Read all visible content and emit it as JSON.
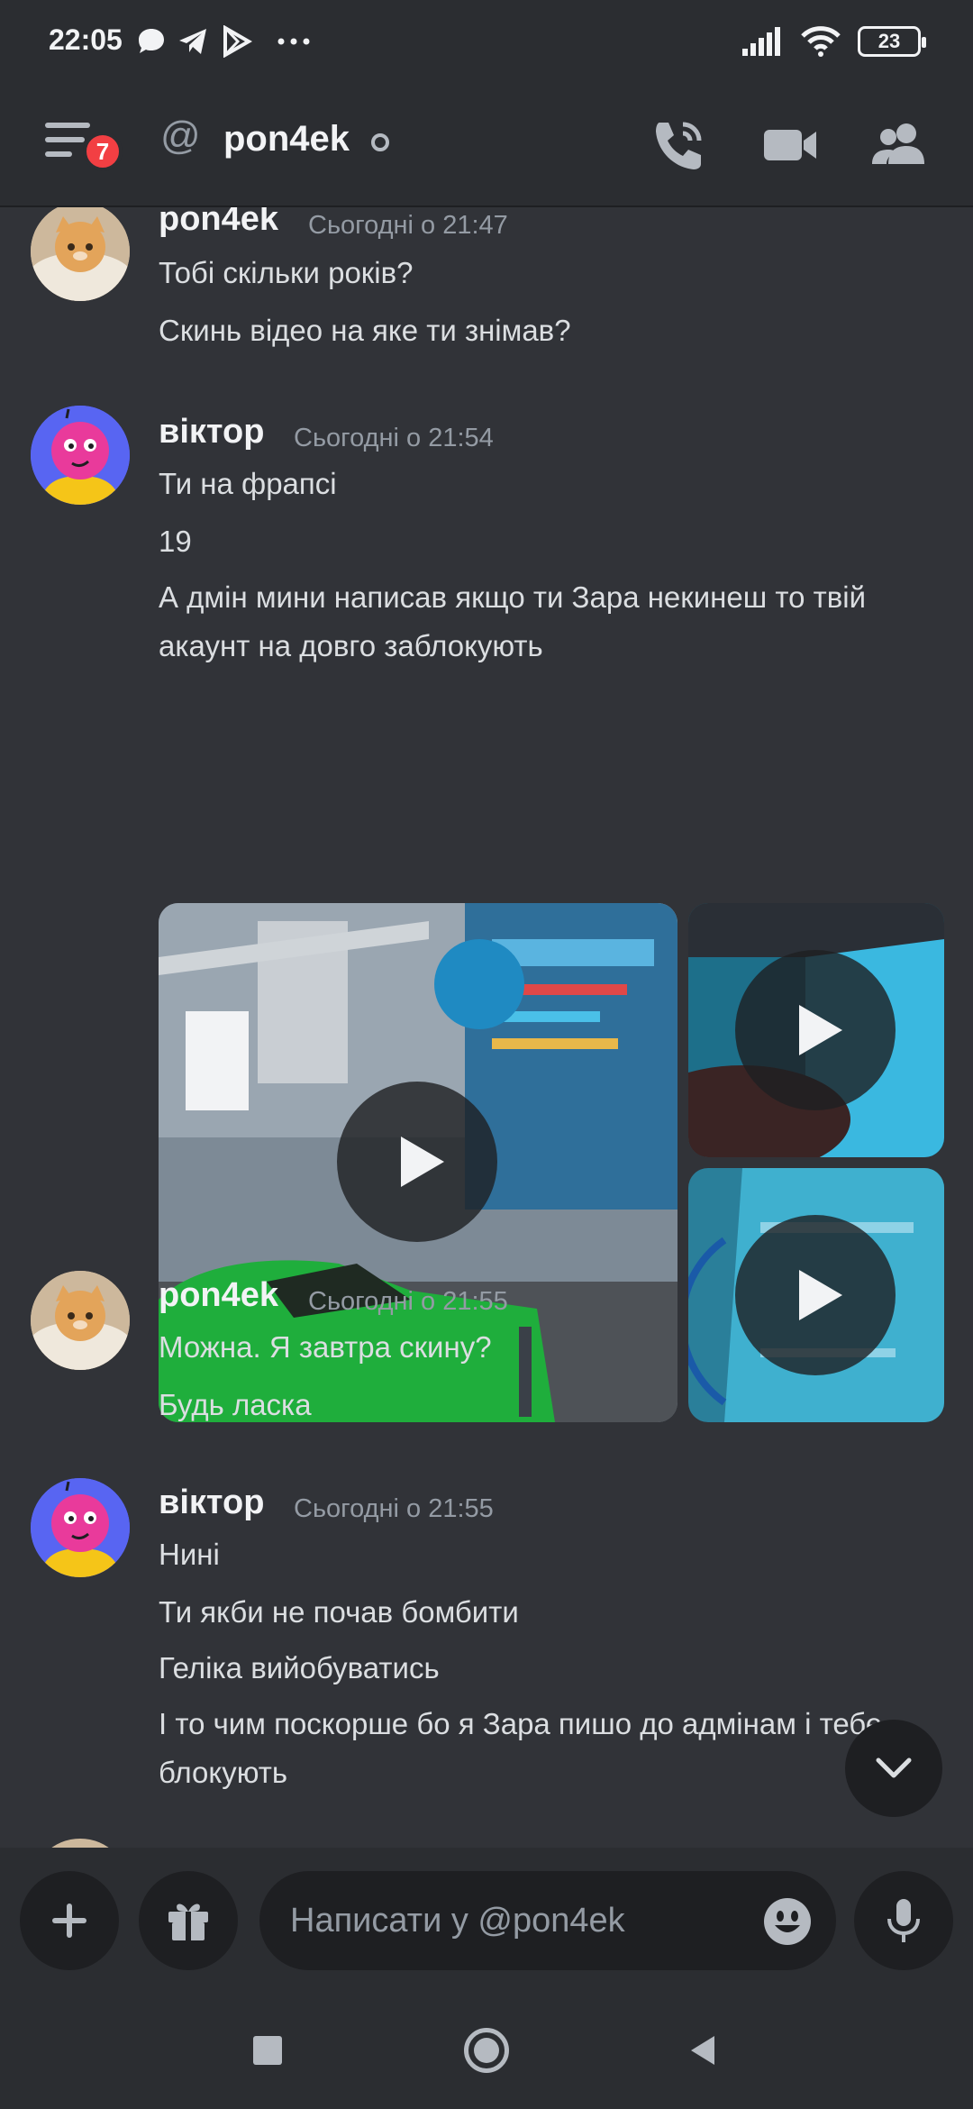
{
  "status_bar": {
    "time": "22:05",
    "battery": "23"
  },
  "header": {
    "unread_count": "7",
    "at_symbol": "@",
    "title": "pon4ek"
  },
  "messages": [
    {
      "username": "pon4ek",
      "timestamp": "Сьогодні о 21:47",
      "lines": [
        "Тобі скільки років?",
        "Скинь відео на яке ти знімав?"
      ]
    },
    {
      "username": "віктор",
      "timestamp": "Сьогодні о 21:54",
      "lines": [
        "Ти на фрапсі",
        "19",
        "А дмін мини написав якщо ти Зара некинеш то твій акаунт на довго заблокують"
      ],
      "attachments": [
        "video",
        "video",
        "video"
      ]
    },
    {
      "username": "pon4ek",
      "timestamp": "Сьогодні о 21:55",
      "lines": [
        "Можна. Я завтра скину?",
        "Будь ласка"
      ]
    },
    {
      "username": "віктор",
      "timestamp": "Сьогодні о 21:55",
      "lines": [
        "Нині",
        "Ти якби не почав бомбити",
        "Геліка вийобуватись",
        "І то чим поскорше бо я Зара пишо до адмінам і тебе блокують"
      ]
    }
  ],
  "composer": {
    "placeholder": "Написати у @pon4ek"
  },
  "icons": {
    "menu": "hamburger-menu-icon",
    "call": "phone-call-icon",
    "video": "video-camera-icon",
    "members": "members-icon",
    "add": "plus-icon",
    "gift": "gift-icon",
    "emoji": "emoji-icon",
    "mic": "microphone-icon"
  },
  "colors": {
    "background": "#313338",
    "badge": "#f23f43",
    "text": "#dbdee1"
  }
}
